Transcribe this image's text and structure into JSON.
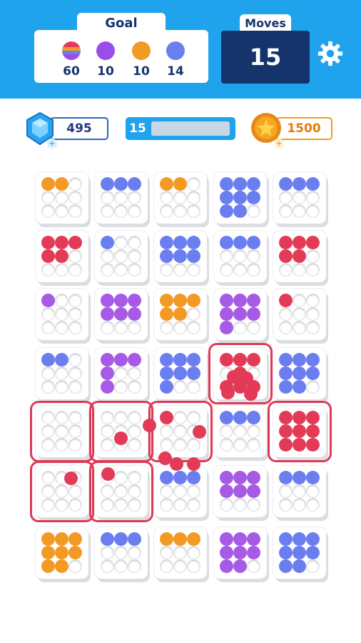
{
  "goal": {
    "title": "Goal",
    "items": [
      {
        "color": "striped",
        "count": "60"
      },
      {
        "color": "#9b4de8",
        "count": "10"
      },
      {
        "color": "#f39a25",
        "count": "10"
      },
      {
        "color": "#6b7ef0",
        "count": "14"
      }
    ]
  },
  "moves": {
    "label": "Moves",
    "value": "15"
  },
  "gems": {
    "value": "495"
  },
  "level": {
    "value": "15",
    "progress": 0
  },
  "coins": {
    "value": "1500"
  },
  "colors": {
    "orange": "#f39a25",
    "blue": "#6b7ef0",
    "red": "#e33b57",
    "purple": "#a65ae6"
  },
  "board": [
    [
      {
        "color": "orange",
        "filled": [
          0,
          1
        ]
      },
      {
        "color": "blue",
        "filled": [
          0,
          1,
          2
        ]
      },
      {
        "color": "orange",
        "filled": [
          0,
          1
        ]
      },
      {
        "color": "blue",
        "filled": [
          0,
          1,
          2,
          3,
          4,
          5,
          6,
          7
        ]
      },
      {
        "color": "blue",
        "filled": [
          0,
          1,
          2
        ]
      }
    ],
    [
      {
        "color": "red",
        "filled": [
          0,
          1,
          2,
          3,
          4
        ]
      },
      {
        "color": "blue",
        "filled": [
          0
        ]
      },
      {
        "color": "blue",
        "filled": [
          0,
          1,
          2,
          3,
          4,
          5
        ]
      },
      {
        "color": "blue",
        "filled": [
          0,
          1,
          2
        ]
      },
      {
        "color": "red",
        "filled": [
          0,
          1,
          2,
          3,
          4
        ]
      }
    ],
    [
      {
        "color": "purple",
        "filled": [
          0
        ]
      },
      {
        "color": "purple",
        "filled": [
          0,
          1,
          2,
          3,
          4,
          5
        ]
      },
      {
        "color": "orange",
        "filled": [
          0,
          1,
          2,
          3,
          4
        ]
      },
      {
        "color": "purple",
        "filled": [
          0,
          1,
          2,
          3,
          4,
          5,
          6
        ]
      },
      {
        "color": "red",
        "filled": [
          0
        ]
      }
    ],
    [
      {
        "color": "blue",
        "filled": [
          0,
          1
        ]
      },
      {
        "color": "purple",
        "filled": [
          0,
          1,
          2,
          3,
          6
        ]
      },
      {
        "color": "blue",
        "filled": [
          0,
          1,
          2,
          3,
          4,
          5,
          6
        ]
      },
      {
        "color": "red",
        "filled": [
          0,
          1,
          2,
          4,
          6,
          7,
          8
        ],
        "highlight": true
      },
      {
        "color": "blue",
        "filled": [
          0,
          1,
          2,
          3,
          4,
          5,
          6,
          7
        ]
      }
    ],
    [
      {
        "color": "red",
        "filled": [],
        "highlight": true
      },
      {
        "color": "red",
        "filled": [],
        "highlight": true
      },
      {
        "color": "red",
        "filled": [
          0
        ],
        "highlight": true
      },
      {
        "color": "blue",
        "filled": [
          0,
          1,
          2
        ]
      },
      {
        "color": "red",
        "filled": [
          0,
          1,
          2,
          3,
          4,
          5,
          6,
          7,
          8
        ],
        "highlight": true
      }
    ],
    [
      {
        "color": "red",
        "filled": [],
        "highlight": true
      },
      {
        "color": "red",
        "filled": [],
        "highlight": true
      },
      {
        "color": "blue",
        "filled": [
          0,
          1,
          2
        ]
      },
      {
        "color": "purple",
        "filled": [
          0,
          1,
          2,
          3,
          4,
          5
        ]
      },
      {
        "color": "blue",
        "filled": [
          0,
          1,
          2
        ]
      }
    ],
    [
      {
        "color": "orange",
        "filled": [
          0,
          1,
          2,
          3,
          4,
          5,
          6,
          7
        ]
      },
      {
        "color": "blue",
        "filled": [
          0,
          1,
          2
        ]
      },
      {
        "color": "orange",
        "filled": [
          0,
          1,
          2
        ]
      },
      {
        "color": "purple",
        "filled": [
          0,
          1,
          2,
          3,
          4,
          5,
          6,
          7
        ]
      },
      {
        "color": "blue",
        "filled": [
          0,
          1,
          2,
          3,
          4,
          5,
          6,
          7
        ]
      }
    ]
  ]
}
